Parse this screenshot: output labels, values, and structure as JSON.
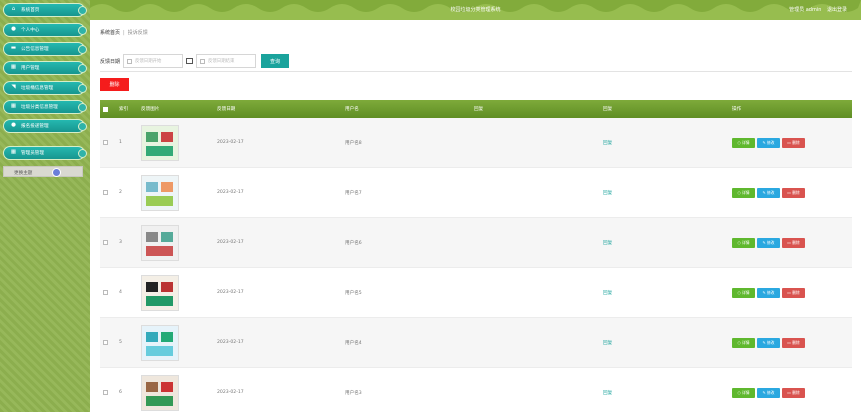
{
  "sidebar": {
    "items": [
      {
        "label": "系统首页",
        "icon": "home-icon"
      },
      {
        "label": "个人中心",
        "icon": "user-icon"
      },
      {
        "label": "公告信息管理",
        "icon": "notice-icon"
      },
      {
        "label": "用户管理",
        "icon": "grid-icon"
      },
      {
        "label": "垃圾桶信息管理",
        "icon": "bin-icon"
      },
      {
        "label": "垃圾分类信息管理",
        "icon": "grid-icon"
      },
      {
        "label": "报名投递管理",
        "icon": "user-icon"
      },
      {
        "label": "管理员管理",
        "icon": "grid-icon"
      }
    ],
    "theme_label": "更换主题"
  },
  "header": {
    "title": "校园垃圾分类管理系统",
    "admin_text": "管理员 admin",
    "logout": "退出登录"
  },
  "breadcrumb": {
    "home": "系统首页",
    "current": "投诉反馈"
  },
  "search": {
    "label": "反馈日期",
    "start_placeholder": "反馈日期开始",
    "end_placeholder": "反馈日期结束",
    "button": "查询"
  },
  "actions": {
    "delete": "删除"
  },
  "table": {
    "headers": [
      "索引",
      "反馈图片",
      "反馈日期",
      "用户名",
      "回复",
      "回复",
      "操作"
    ],
    "op_labels": {
      "detail": "详情",
      "edit": "修改",
      "delete": "删除"
    },
    "rows": [
      {
        "index": "1",
        "date": "2023-02-17",
        "user": "用户名8",
        "feedback": "",
        "reply": "回复"
      },
      {
        "index": "2",
        "date": "2023-02-17",
        "user": "用户名7",
        "feedback": "",
        "reply": "回复"
      },
      {
        "index": "3",
        "date": "2023-02-17",
        "user": "用户名6",
        "feedback": "",
        "reply": "回复"
      },
      {
        "index": "4",
        "date": "2023-02-17",
        "user": "用户名5",
        "feedback": "",
        "reply": "回复"
      },
      {
        "index": "5",
        "date": "2023-02-17",
        "user": "用户名4",
        "feedback": "",
        "reply": "回复"
      },
      {
        "index": "6",
        "date": "2023-02-17",
        "user": "用户名3",
        "feedback": "",
        "reply": "回复"
      }
    ]
  },
  "colors": {
    "sidebar_bg": "#8fb052",
    "menu_teal": "#1ea9a1",
    "header_green": "#97bd4f",
    "table_head": "#6e9c2f",
    "delete_red": "#f51c1c",
    "search_teal": "#1aa39c"
  }
}
